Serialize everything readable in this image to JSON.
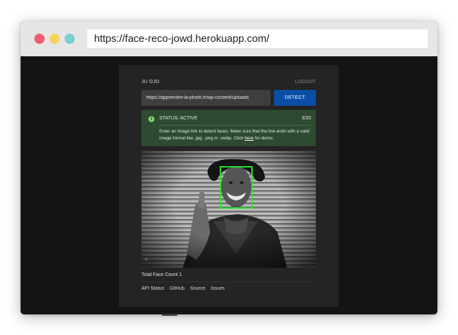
{
  "browser": {
    "url": "https://face-reco-jowd.herokuapp.com/"
  },
  "app": {
    "user_name": "JU OJO",
    "logout_label": "LOGOUT",
    "image_url_value": "https://apprendre-la-photo.fr/wp-content/uploads",
    "detect_label": "DETECT",
    "status": {
      "label": "STATUS: ACTIVE",
      "count": "3/20",
      "description_before": "Enter an image link to detect faces. Make sure that the link ends with a valid image format like .jpg, .png or .webp. Click ",
      "link_text": "here",
      "description_after": " for demo."
    },
    "image": {
      "watermark": "©  "
    },
    "face_count_label": "Total Face Count 1",
    "footer_links": [
      "API Status",
      "GitHub",
      "Source",
      "Issues"
    ]
  },
  "colors": {
    "window_bg": "#141414",
    "panel_bg": "#242424",
    "accent_blue": "#0b4ea8",
    "status_green_bg": "#2e4a31",
    "face_box_green": "#2ee12e"
  },
  "icons": {
    "status": "info-icon",
    "window_controls": [
      "close-dot",
      "minimize-dot",
      "maximize-dot"
    ]
  }
}
